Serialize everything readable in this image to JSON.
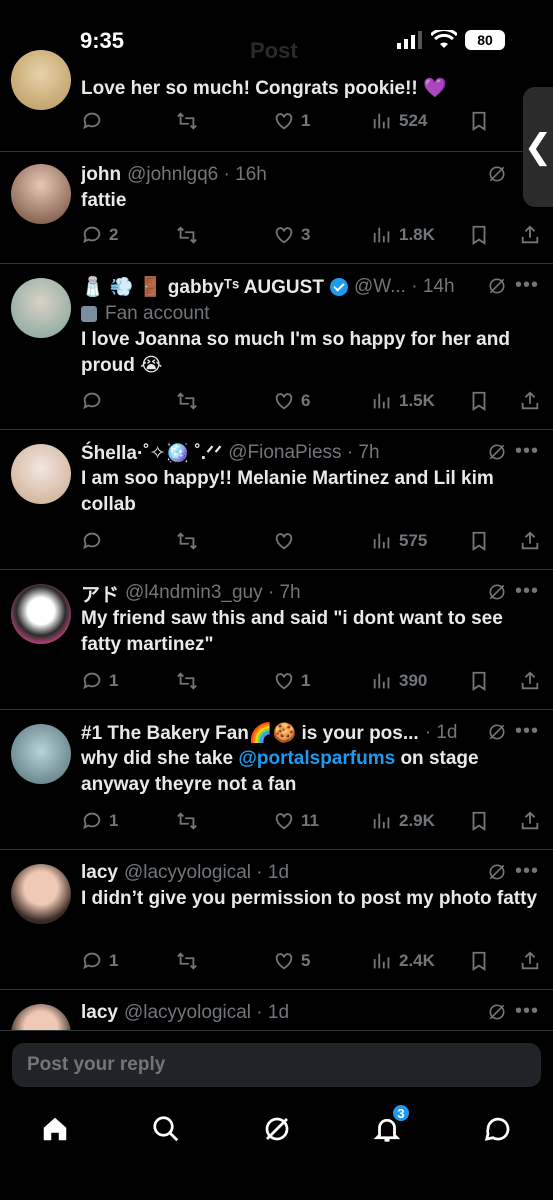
{
  "status": {
    "time": "9:35",
    "battery": "80"
  },
  "header": {
    "title": "Post"
  },
  "replies": [
    {
      "text": "Love her so much! Congrats pookie!! 💜",
      "replies": "",
      "likes": "1",
      "views": "524"
    },
    {
      "name": "john",
      "meta": "@johnlgq6 · 16h",
      "text": "fattie",
      "replies": "2",
      "likes": "3",
      "views": "1.8K"
    },
    {
      "name": "🧂 💨 🚪 gabbyᵀˢ AUGUST",
      "meta": "@W... · 14h",
      "badge": "Fan account",
      "text": "I love Joanna so much I'm so happy for her and proud 😭",
      "replies": "",
      "likes": "6",
      "views": "1.5K"
    },
    {
      "name": "Śhella·˚✧🪩 ˚.ᐟᐟ",
      "meta": "@FionaPiess · 7h",
      "text": "I am soo happy!! Melanie Martinez and Lil kim collab",
      "replies": "",
      "likes": "",
      "views": "575"
    },
    {
      "name": "アド",
      "meta": "@l4ndmin3_guy · 7h",
      "text": "My friend saw this and said \"i dont want to see fatty martinez\"",
      "replies": "1",
      "likes": "1",
      "views": "390"
    },
    {
      "name": "#1 The Bakery Fan🌈🍪 is your pos...",
      "meta": "· 1d",
      "text_before": "why did she take ",
      "mention": "@portalsparfums",
      "text_after": " on stage anyway theyre not a fan",
      "replies": "1",
      "likes": "11",
      "views": "2.9K"
    },
    {
      "name": "lacy",
      "meta": "@lacyyological · 1d",
      "text": "I didn’t give you permission to post my photo fatty",
      "replies": "1",
      "likes": "5",
      "views": "2.4K"
    },
    {
      "name": "lacy",
      "meta": "@lacyyological · 1d"
    }
  ],
  "compose": {
    "placeholder": "Post your reply"
  },
  "nav": {
    "notifications_count": "3"
  },
  "colors": {
    "background": "#000000",
    "accent": "#1d9bf0",
    "muted": "#71767b",
    "text": "#e7e9ea"
  }
}
